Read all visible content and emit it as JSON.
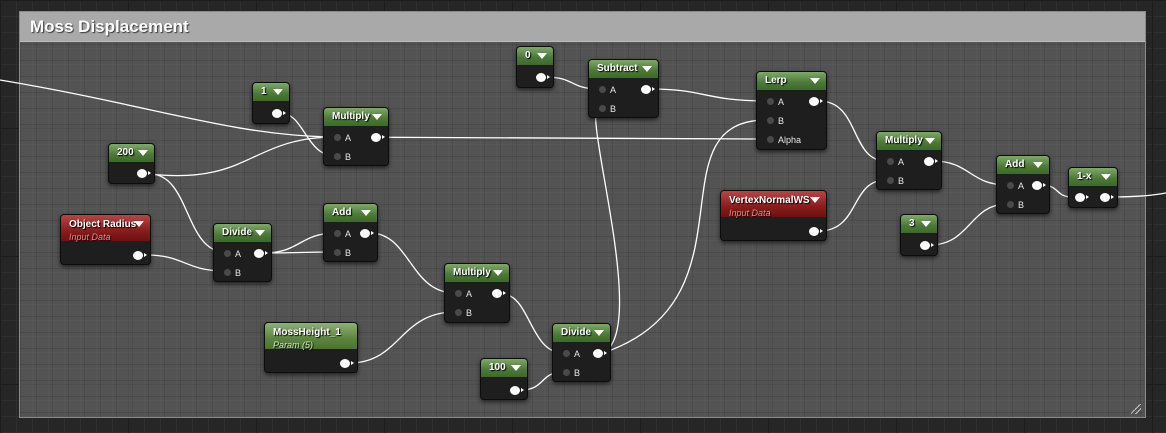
{
  "comment": {
    "title": "Moss Displacement"
  },
  "colors": {
    "function_header": "#4b7837",
    "input_data_header": "#8a1c1c",
    "wire": "#ffffff",
    "pin_output": "#ffffff"
  },
  "icons": {
    "node_menu": "caret-down-icon",
    "output_pin": "output-pin-icon",
    "input_pin": "input-pin-icon"
  },
  "nodes": {
    "const_0": {
      "title": "0"
    },
    "const_1": {
      "title": "1"
    },
    "const_200": {
      "title": "200"
    },
    "const_3": {
      "title": "3"
    },
    "const_100": {
      "title": "100"
    },
    "object_radius": {
      "title": "Object Radius",
      "subtitle": "Input Data"
    },
    "vertex_normal": {
      "title": "VertexNormalWS",
      "subtitle": "Input Data"
    },
    "moss_height": {
      "title": "MossHeight_1",
      "subtitle": "Param (5)"
    },
    "multiply_1": {
      "title": "Multiply",
      "pins": [
        "A",
        "B"
      ]
    },
    "divide_1": {
      "title": "Divide",
      "pins": [
        "A",
        "B"
      ]
    },
    "add_1": {
      "title": "Add",
      "pins": [
        "A",
        "B"
      ]
    },
    "multiply_2": {
      "title": "Multiply",
      "pins": [
        "A",
        "B"
      ]
    },
    "divide_2": {
      "title": "Divide",
      "pins": [
        "A",
        "B"
      ]
    },
    "subtract": {
      "title": "Subtract",
      "pins": [
        "A",
        "B"
      ]
    },
    "lerp": {
      "title": "Lerp",
      "pins": [
        "A",
        "B",
        "Alpha"
      ]
    },
    "multiply_3": {
      "title": "Multiply",
      "pins": [
        "A",
        "B"
      ]
    },
    "add_2": {
      "title": "Add",
      "pins": [
        "A",
        "B"
      ]
    },
    "one_minus": {
      "title": "1-x"
    }
  }
}
